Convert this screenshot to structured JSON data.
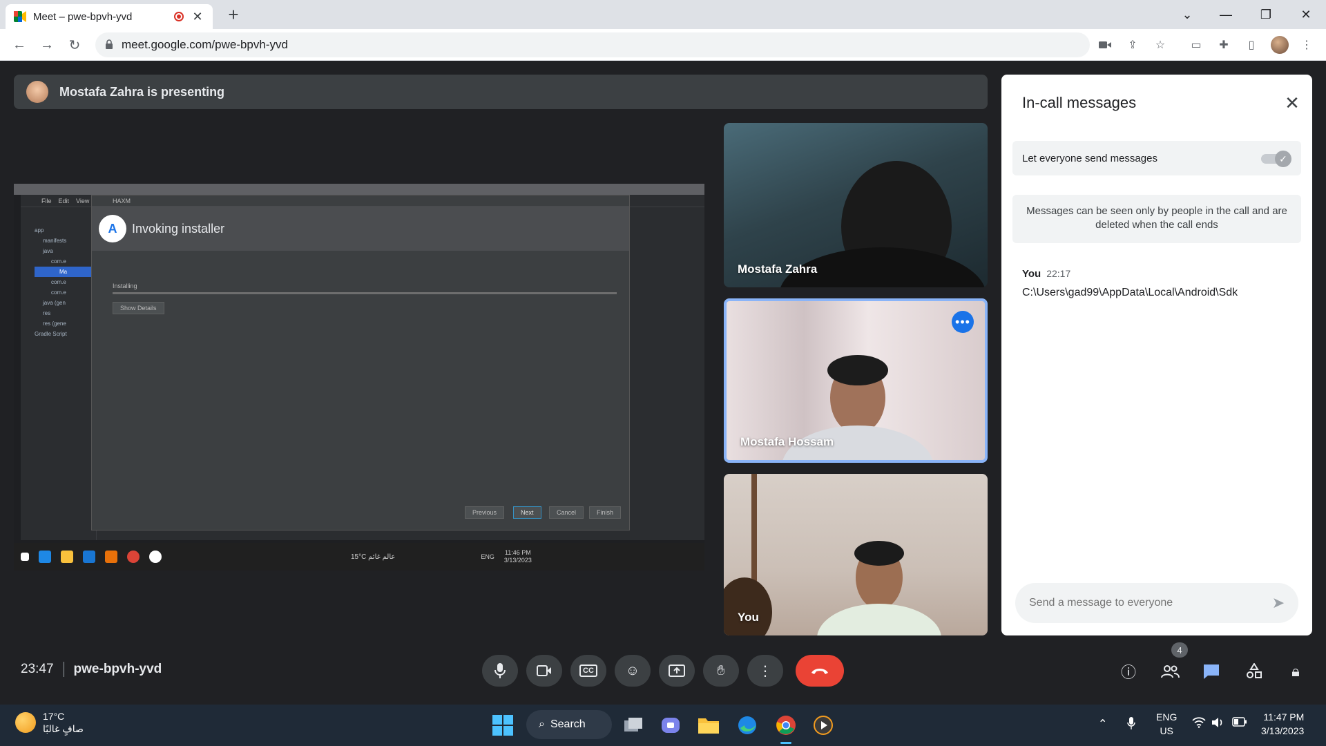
{
  "browser": {
    "tab_title": "Meet – pwe-bpvh-yvd",
    "new_tab": "+",
    "url": "meet.google.com/pwe-bpvh-yvd"
  },
  "meet": {
    "presenting_text": "Mostafa Zahra is presenting",
    "shared_screen": {
      "dialog_title": "HAXM",
      "header": "Invoking installer",
      "status": "Installing",
      "show_details": "Show Details",
      "buttons": [
        "Previous",
        "Next",
        "Cancel",
        "Finish"
      ],
      "ide_menu": [
        "File",
        "Edit",
        "View"
      ],
      "tree": [
        "app",
        "manifests",
        "java",
        "com.e",
        "Ma",
        "com.e",
        "com.e",
        "java (gen",
        "res",
        "res (gene",
        "Gradle Script"
      ],
      "taskbar_weather": "15°C عالم غائم",
      "taskbar_time": "11:46 PM",
      "taskbar_date": "3/13/2023",
      "taskbar_lang": "ENG"
    },
    "participants": [
      {
        "name": "Mostafa Zahra"
      },
      {
        "name": "Mostafa Hossam"
      },
      {
        "name": "You"
      }
    ],
    "panel": {
      "title": "In-call messages",
      "toggle_label": "Let everyone send messages",
      "notice": "Messages can be seen only by people in the call and are deleted when the call ends",
      "messages": [
        {
          "author": "You",
          "time": "22:17",
          "text": "C:\\Users\\gad99\\AppData\\Local\\Android\\Sdk"
        }
      ],
      "composer_placeholder": "Send a message to everyone"
    },
    "bottom": {
      "time": "23:47",
      "meeting_code": "pwe-bpvh-yvd",
      "people_count": "4"
    }
  },
  "taskbar": {
    "temperature": "17°C",
    "weather_desc": "صافٍ غالبًا",
    "search_label": "Search",
    "lang_top": "ENG",
    "lang_bottom": "US",
    "time": "11:47 PM",
    "date": "3/13/2023"
  },
  "colors": {
    "meet_bg": "#202124",
    "accent_blue": "#1a73e8",
    "end_call_red": "#ea4335",
    "speaking_border": "#8ab4f8"
  }
}
